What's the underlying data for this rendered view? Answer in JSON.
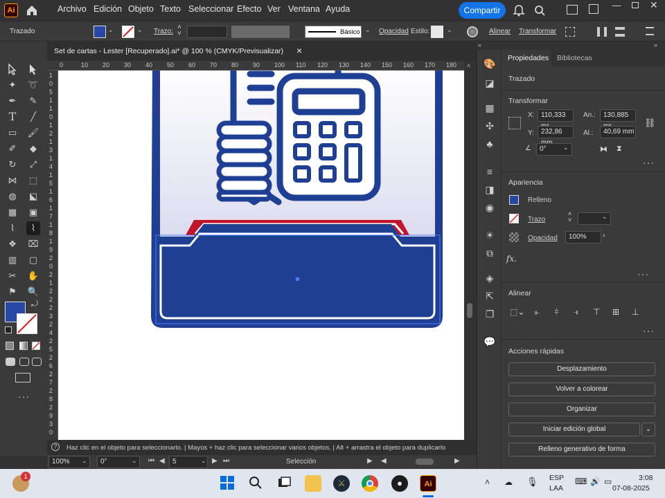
{
  "app": {
    "logo": "Ai",
    "menu": [
      "Archivo",
      "Edición",
      "Objeto",
      "Texto",
      "Seleccionar",
      "Efecto",
      "Ver",
      "Ventana",
      "Ayuda"
    ],
    "share_label": "Compartir"
  },
  "control_bar": {
    "object_type": "Trazado",
    "stroke_label": "Trazo:",
    "stroke_style": "Básico",
    "opacity_label": "Opacidad",
    "style_label": "Estilo:",
    "align_label": "Alinear",
    "transform_label": "Transformar"
  },
  "document_tab": {
    "title": "Set de cartas - Lester [Recuperado].ai* @ 100 % (CMYK/Previsualizar)",
    "close": "×"
  },
  "ruler": {
    "h_ticks": [
      "0",
      "10",
      "20",
      "30",
      "40",
      "50",
      "60",
      "70",
      "80",
      "90",
      "100",
      "110",
      "120",
      "130",
      "140",
      "150",
      "160",
      "170",
      "180"
    ],
    "v_ticks": [
      "1",
      "0",
      "5",
      "1",
      "1",
      "0",
      "1",
      "2",
      "1",
      "3",
      "1",
      "4",
      "1",
      "5",
      "1",
      "6",
      "1",
      "7",
      "1",
      "8",
      "1",
      "9",
      "2",
      "0",
      "2",
      "1",
      "2",
      "2",
      "2",
      "3",
      "2",
      "4",
      "2",
      "5",
      "2",
      "6",
      "2",
      "7",
      "2",
      "8",
      "2",
      "9",
      "3",
      "0"
    ]
  },
  "status": {
    "hint": "Haz clic en el objeto para seleccionarlo.  |  Mayús + haz clic para seleccionar varios objetos.  |  Alt + arrastra el objeto para duplicarlo",
    "zoom": "100%",
    "rotation": "0°",
    "artboard_num": "5",
    "tool_name": "Selección"
  },
  "properties": {
    "tabs": [
      "Propiedades",
      "Bibliotecas"
    ],
    "object_type": "Trazado",
    "transform_title": "Transformar",
    "x_label": "X:",
    "x_value": "110,333 mr",
    "y_label": "Y:",
    "y_value": "232,86 mm",
    "w_label": "An.:",
    "w_value": "130,885 mr",
    "h_label": "Al.:",
    "h_value": "40,69 mm",
    "angle_value": "0°",
    "appearance_title": "Apariencia",
    "fill_label": "Relleno",
    "stroke_label": "Trazo",
    "opacity_label": "Opacidad",
    "opacity_value": "100%",
    "fx_label": "fx.",
    "align_title": "Alinear",
    "quick_actions_title": "Acciones rápidas",
    "quick_actions": [
      "Desplazamiento",
      "Volver a colorear",
      "Organizar",
      "Iniciar edición global",
      "Relleno generativo de forma"
    ]
  },
  "taskbar": {
    "notification_count": "1",
    "lang_top": "ESP",
    "lang_bottom": "LAA",
    "time": "3:08",
    "date": "07-08-2025"
  },
  "colors": {
    "accent_blue": "#1473e6",
    "card_blue": "#1e3f94",
    "card_red": "#c0152a",
    "fill_swatch": "#2847a5"
  }
}
